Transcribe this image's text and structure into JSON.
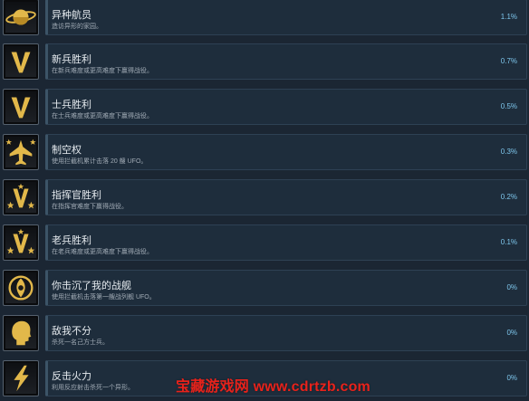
{
  "achievements": [
    {
      "title": "异种航员",
      "desc": "造访异形的家园。",
      "percent": "1.1%",
      "icon": "planet-icon"
    },
    {
      "title": "新兵胜利",
      "desc": "在新兵难度或更高难度下赢得战役。",
      "percent": "0.7%",
      "icon": "chevron-rank-icon"
    },
    {
      "title": "士兵胜利",
      "desc": "在士兵难度或更高难度下赢得战役。",
      "percent": "0.5%",
      "icon": "chevron-rank-icon"
    },
    {
      "title": "制空权",
      "desc": "使用拦截机累计击落 20 艘 UFO。",
      "percent": "0.3%",
      "icon": "fighter-jet-icon"
    },
    {
      "title": "指挥官胜利",
      "desc": "在指挥官难度下赢得战役。",
      "percent": "0.2%",
      "icon": "chevron-star-rank-icon"
    },
    {
      "title": "老兵胜利",
      "desc": "在老兵难度或更高难度下赢得战役。",
      "percent": "0.1%",
      "icon": "chevron-star-rank-icon"
    },
    {
      "title": "你击沉了我的战舰",
      "desc": "使用拦截机击落第一艘战列舰 UFO。",
      "percent": "0%",
      "icon": "xcom-emblem-icon"
    },
    {
      "title": "敌我不分",
      "desc": "杀死一名己方士兵。",
      "percent": "0%",
      "icon": "head-silhouette-icon"
    },
    {
      "title": "反击火力",
      "desc": "利用反应射击杀死一个异形。",
      "percent": "0%",
      "icon": "lightning-bolt-icon"
    }
  ],
  "watermark": "宝藏游戏网 www.cdrtzb.com",
  "colors": {
    "percent": "#7ec6ec",
    "panel": "#1e2d3c",
    "background": "#1b2633",
    "badge_gold": "#e2b84a",
    "watermark": "#e8221b"
  }
}
